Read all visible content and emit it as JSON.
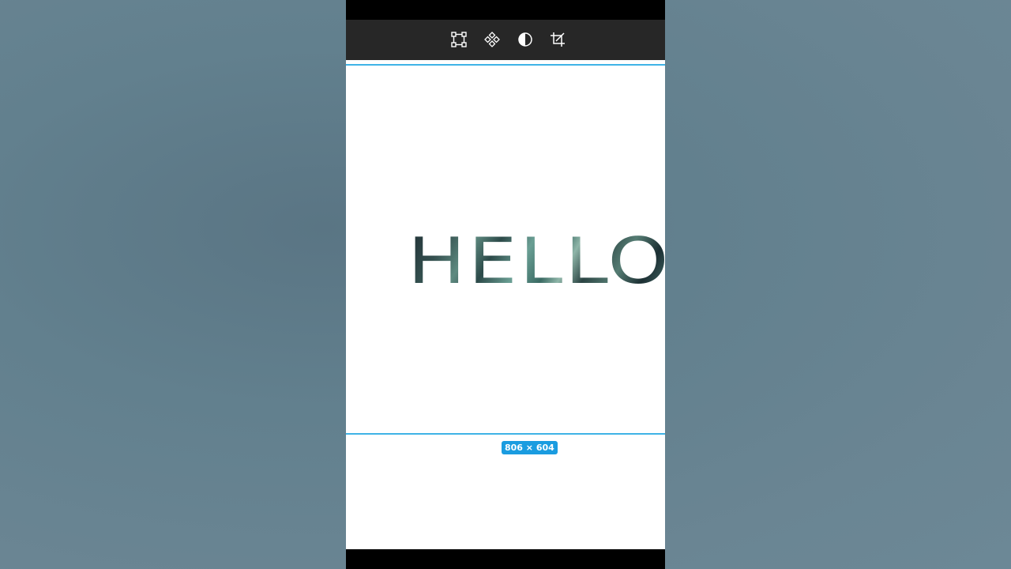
{
  "toolbar": {
    "tools": [
      {
        "icon": "transform-icon"
      },
      {
        "icon": "component-icon"
      },
      {
        "icon": "adjust-contrast-icon"
      },
      {
        "icon": "crop-icon"
      }
    ]
  },
  "canvas": {
    "text": "HELLO",
    "dimension_badge": "806 × 604",
    "guide_color": "#3fb3e6",
    "badge_color": "#1a9ce0"
  }
}
